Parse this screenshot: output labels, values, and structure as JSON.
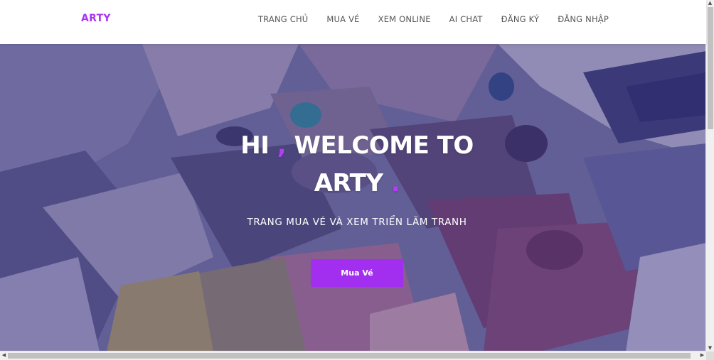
{
  "header": {
    "logo": "ARTY",
    "nav": [
      {
        "label": "TRANG CHỦ"
      },
      {
        "label": "MUA VÉ"
      },
      {
        "label": "XEM ONLINE"
      },
      {
        "label": "AI CHAT"
      },
      {
        "label": "ĐĂNG KÝ"
      },
      {
        "label": "ĐĂNG NHẬP"
      }
    ]
  },
  "hero": {
    "title_part1": "HI",
    "title_comma": ",",
    "title_part2": "WELCOME TO",
    "title_part3": "ARTY",
    "title_dot": ".",
    "subtitle": "TRANG MUA VÉ VÀ XEM TRIỂN LÃM TRANH",
    "button_label": "Mua Vé"
  },
  "colors": {
    "accent": "#a935f0",
    "button": "#a22ff0",
    "nav_text": "#555555"
  },
  "icons": {
    "scroll_up": "triangle-up",
    "scroll_down": "triangle-down",
    "scroll_left": "triangle-left",
    "scroll_right": "triangle-right"
  }
}
